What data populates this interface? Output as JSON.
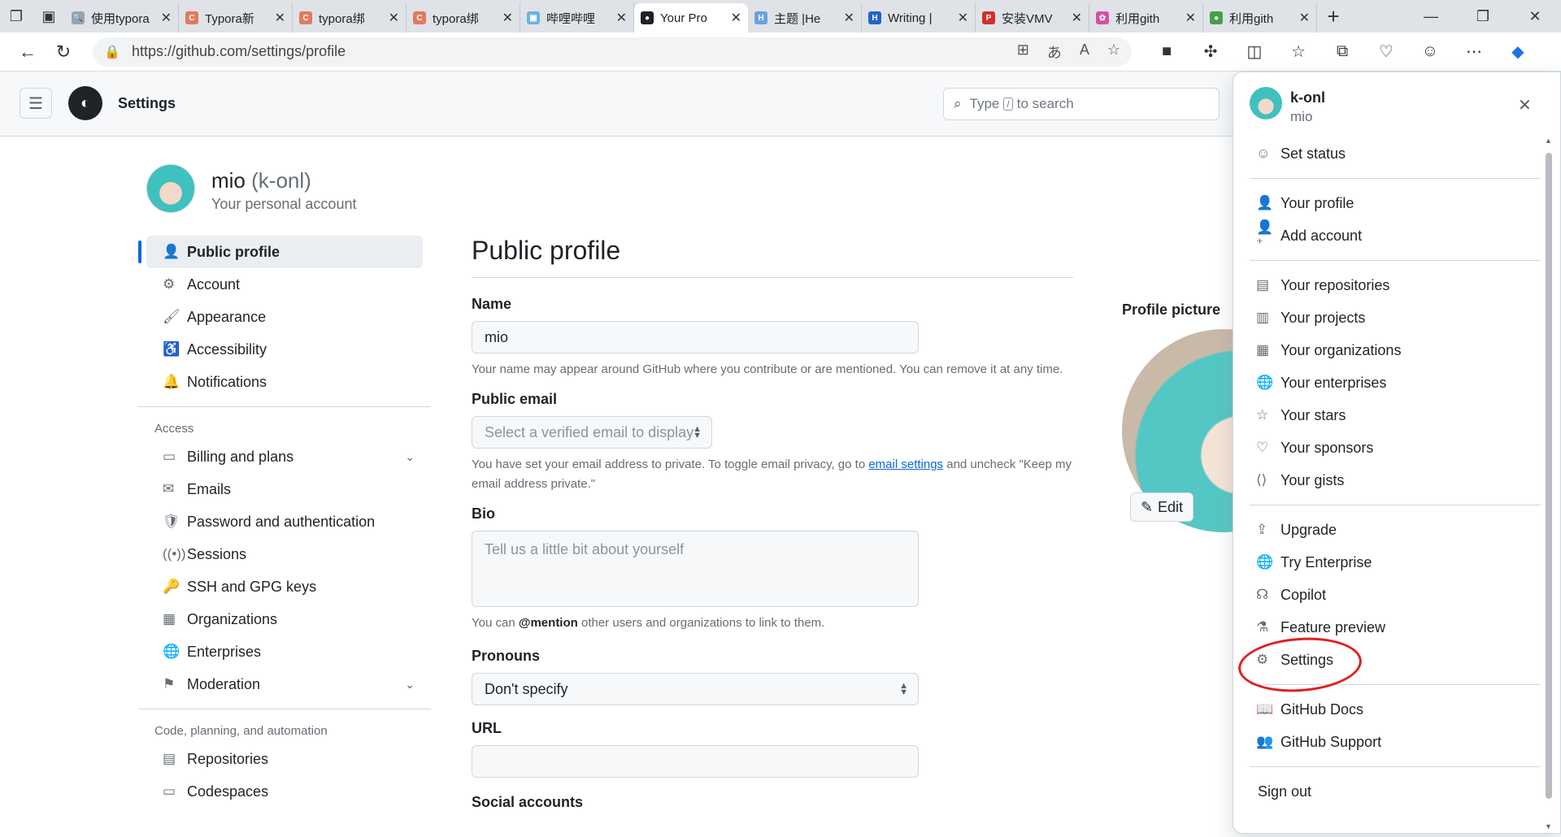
{
  "browser": {
    "tabs": [
      {
        "title": "使用typora",
        "favicon_color": "#9aa4b0",
        "favicon": "🔍"
      },
      {
        "title": "Typora新",
        "favicon_color": "#e07a5f",
        "favicon": "C"
      },
      {
        "title": "typora绑",
        "favicon_color": "#e07a5f",
        "favicon": "C"
      },
      {
        "title": "typora绑",
        "favicon_color": "#e07a5f",
        "favicon": "C"
      },
      {
        "title": "哔哩哔哩",
        "favicon_color": "#6db3e0",
        "favicon": "▣"
      },
      {
        "title": "Your Pro",
        "favicon_color": "#1f2328",
        "favicon": "●"
      },
      {
        "title": "主题 |He",
        "favicon_color": "#6a9fe0",
        "favicon": "H"
      },
      {
        "title": "Writing |",
        "favicon_color": "#2563c9",
        "favicon": "H"
      },
      {
        "title": "安装VMV",
        "favicon_color": "#d32f2f",
        "favicon": "P"
      },
      {
        "title": "利用gith",
        "favicon_color": "#d84fa3",
        "favicon": "✿"
      },
      {
        "title": "利用gith",
        "favicon_color": "#43a047",
        "favicon": "●"
      }
    ],
    "active_tab_index": 5,
    "url": "https://github.com/settings/profile"
  },
  "header": {
    "title": "Settings",
    "search_pre": "Type",
    "search_key": "/",
    "search_post": "to search"
  },
  "profile": {
    "name": "mio",
    "handle": "(k-onl)",
    "subtitle": "Your personal account"
  },
  "sidebar": {
    "top_items": [
      {
        "label": "Public profile",
        "icon": "person-icon",
        "glyph": "👤",
        "selected": true
      },
      {
        "label": "Account",
        "icon": "gear-icon",
        "glyph": "⚙"
      },
      {
        "label": "Appearance",
        "icon": "paintbrush-icon",
        "glyph": "🖌"
      },
      {
        "label": "Accessibility",
        "icon": "accessibility-icon",
        "glyph": "♿"
      },
      {
        "label": "Notifications",
        "icon": "bell-icon",
        "glyph": "🔔"
      }
    ],
    "access_title": "Access",
    "access_items": [
      {
        "label": "Billing and plans",
        "icon": "credit-card-icon",
        "glyph": "▭",
        "chevron": true
      },
      {
        "label": "Emails",
        "icon": "mail-icon",
        "glyph": "✉"
      },
      {
        "label": "Password and authentication",
        "icon": "shield-lock-icon",
        "glyph": "🛡"
      },
      {
        "label": "Sessions",
        "icon": "broadcast-icon",
        "glyph": "((•))"
      },
      {
        "label": "SSH and GPG keys",
        "icon": "key-icon",
        "glyph": "🔑"
      },
      {
        "label": "Organizations",
        "icon": "organization-icon",
        "glyph": "▦"
      },
      {
        "label": "Enterprises",
        "icon": "globe-icon",
        "glyph": "🌐"
      },
      {
        "label": "Moderation",
        "icon": "report-icon",
        "glyph": "⚑",
        "chevron": true
      }
    ],
    "code_title": "Code, planning, and automation",
    "code_items": [
      {
        "label": "Repositories",
        "icon": "repo-icon",
        "glyph": "▤"
      },
      {
        "label": "Codespaces",
        "icon": "codespaces-icon",
        "glyph": "▭"
      }
    ]
  },
  "main": {
    "title": "Public profile",
    "name_label": "Name",
    "name_value": "mio",
    "name_note": "Your name may appear around GitHub where you contribute or are mentioned. You can remove it at any time.",
    "email_label": "Public email",
    "email_placeholder": "Select a verified email to display",
    "email_note_pre": "You have set your email address to private. To toggle email privacy, go to",
    "email_note_link": "email settings",
    "email_note_post": "and uncheck \"Keep my email address private.\"",
    "bio_label": "Bio",
    "bio_placeholder": "Tell us a little bit about yourself",
    "bio_note_pre": "You can",
    "bio_note_mention": "@mention",
    "bio_note_post": "other users and organizations to link to them.",
    "pronouns_label": "Pronouns",
    "pronouns_value": "Don't specify",
    "url_label": "URL",
    "url_value": "",
    "social_label": "Social accounts",
    "picture_label": "Profile picture",
    "edit_label": "Edit"
  },
  "user_menu": {
    "login": "k-onl",
    "name": "mio",
    "groups": [
      [
        {
          "label": "Set status",
          "icon": "smiley-icon",
          "glyph": "☺"
        }
      ],
      [
        {
          "label": "Your profile",
          "icon": "person-icon",
          "glyph": "👤"
        },
        {
          "label": "Add account",
          "icon": "person-add-icon",
          "glyph": "👤⁺"
        }
      ],
      [
        {
          "label": "Your repositories",
          "icon": "repo-icon",
          "glyph": "▤"
        },
        {
          "label": "Your projects",
          "icon": "table-icon",
          "glyph": "▥"
        },
        {
          "label": "Your organizations",
          "icon": "organization-icon",
          "glyph": "▦"
        },
        {
          "label": "Your enterprises",
          "icon": "globe-icon",
          "glyph": "🌐"
        },
        {
          "label": "Your stars",
          "icon": "star-icon",
          "glyph": "☆"
        },
        {
          "label": "Your sponsors",
          "icon": "heart-icon",
          "glyph": "♡"
        },
        {
          "label": "Your gists",
          "icon": "code-square-icon",
          "glyph": "⟨⟩"
        }
      ],
      [
        {
          "label": "Upgrade",
          "icon": "upload-icon",
          "glyph": "⇪"
        },
        {
          "label": "Try Enterprise",
          "icon": "globe-icon",
          "glyph": "🌐"
        },
        {
          "label": "Copilot",
          "icon": "copilot-icon",
          "glyph": "☊"
        },
        {
          "label": "Feature preview",
          "icon": "beaker-icon",
          "glyph": "⚗"
        },
        {
          "label": "Settings",
          "icon": "gear-icon",
          "glyph": "⚙"
        }
      ],
      [
        {
          "label": "GitHub Docs",
          "icon": "book-icon",
          "glyph": "📖"
        },
        {
          "label": "GitHub Support",
          "icon": "people-icon",
          "glyph": "👥"
        }
      ],
      [
        {
          "label": "Sign out",
          "icon": "",
          "glyph": ""
        }
      ]
    ]
  }
}
